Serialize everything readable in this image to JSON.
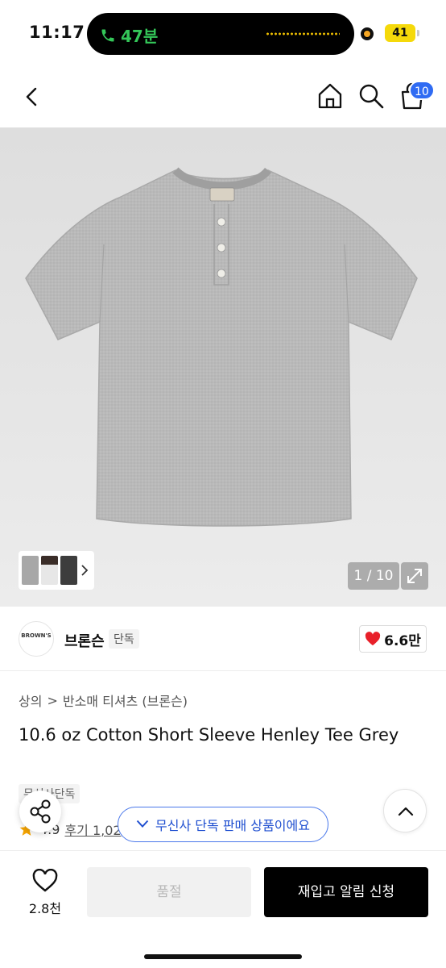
{
  "status_bar": {
    "time": "11:17",
    "call_duration": "47분",
    "battery": "41"
  },
  "header": {
    "cart_count": "10"
  },
  "gallery": {
    "pager": "1 / 10"
  },
  "brand": {
    "logo_text": "BROWN'S",
    "name": "브론슨",
    "tag": "단독",
    "likes": "6.6만"
  },
  "breadcrumb": {
    "category": "상의",
    "separator": ">",
    "subcategory": "반소매 티셔츠 (브론슨)"
  },
  "product": {
    "title": "10.6 oz Cotton Short Sleeve Henley Tee Grey",
    "exclusive_tag": "무신사단독",
    "rating": "4.9",
    "reviews": "후기 1,02"
  },
  "toast": {
    "text": "무신사 단독 판매 상품이에요"
  },
  "bottom_bar": {
    "wish_count": "2.8천",
    "soldout_label": "품절",
    "restock_label": "재입고 알림 신청"
  },
  "colors": {
    "accent_blue": "#2f6bf3",
    "heart_red": "#e8202a",
    "call_green": "#34c759",
    "battery_yellow": "#f5d90a"
  },
  "icons": [
    "back-icon",
    "home-icon",
    "search-icon",
    "cart-icon",
    "expand-icon",
    "heart-icon",
    "share-icon",
    "chevron-up-icon",
    "check-icon",
    "star-icon",
    "phone-icon"
  ]
}
